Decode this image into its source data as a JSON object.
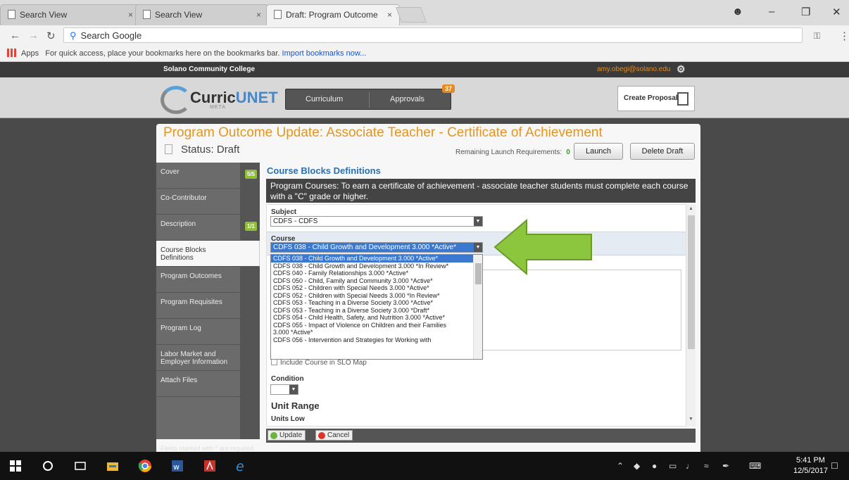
{
  "browser": {
    "tabs": [
      {
        "title": "Search View",
        "active": false
      },
      {
        "title": "Search View",
        "active": false
      },
      {
        "title": "Draft: Program Outcome",
        "active": true
      }
    ],
    "omnibox_text": "Search Google",
    "bookmarks": {
      "apps_label": "Apps",
      "hint": "For quick access, place your bookmarks here on the bookmarks bar.",
      "import_link": "Import bookmarks now..."
    }
  },
  "site": {
    "college": "Solano Community College",
    "email": "amy.obegi@solano.edu",
    "logo_text_a": "Curric",
    "logo_text_b": "UNET",
    "logo_sub": "META",
    "nav": {
      "curriculum": "Curriculum",
      "approvals": "Approvals",
      "approvals_badge": "37"
    },
    "create_proposal": "Create Proposal"
  },
  "page": {
    "title": "Program Outcome Update: Associate Teacher - Certificate of Achievement",
    "status": "Status: Draft",
    "remaining_label": "Remaining Launch Requirements:",
    "remaining_count": "0",
    "launch_label": "Launch",
    "delete_label": "Delete Draft"
  },
  "sidenav": [
    {
      "label": "Cover",
      "count": "5/5"
    },
    {
      "label": "Co-Contributor",
      "count": ""
    },
    {
      "label": "Description",
      "count": "1/1"
    },
    {
      "label": "Course Blocks Definitions",
      "count": "",
      "active": true
    },
    {
      "label": "Program Outcomes",
      "count": ""
    },
    {
      "label": "Program Requisites",
      "count": ""
    },
    {
      "label": "Program Log",
      "count": ""
    },
    {
      "label": "Labor Market and Employer Information",
      "count": ""
    },
    {
      "label": "Attach Files",
      "count": ""
    }
  ],
  "content": {
    "heading": "Course Blocks Definitions",
    "instructions": "Program Courses: To earn a certificate of achievement - associate teacher students must complete each course with a \"C\" grade or higher.",
    "subject_label": "Subject",
    "subject_value": "CDFS - CDFS",
    "course_label": "Course",
    "course_value": "CDFS 038 - Child Growth and Development 3.000 *Active*",
    "include_label": "Include Course in SLO Map",
    "condition_label": "Condition",
    "unit_range_label": "Unit Range",
    "units_low_label": "Units Low",
    "update_label": "Update",
    "cancel_label": "Cancel",
    "required_note": "Fields marked with * are required"
  },
  "course_options": [
    "CDFS 038 - Child Growth and Development 3.000 *Active*",
    "CDFS 038 - Child Growth and Development 3.000 *In Review*",
    "CDFS 040 - Family Relationships 3.000 *Active*",
    "CDFS 050 - Child, Family and Community 3.000 *Active*",
    "CDFS 052 - Children with Special Needs 3.000 *Active*",
    "CDFS 052 - Children with Special Needs 3.000 *In Review*",
    "CDFS 053 - Teaching in a Diverse Society 3.000 *Active*",
    "CDFS 053 - Teaching in a Diverse Society 3.000 *Draft*",
    "CDFS 054 - Child Health, Safety, and Nutrition 3.000 *Active*",
    "CDFS 055 - Impact of Violence on Children and their Families",
    "3.000 *Active*",
    "CDFS 056 - Intervention and Strategies for Working with"
  ],
  "taskbar": {
    "time": "5:41 PM",
    "date": "12/5/2017"
  },
  "colors": {
    "accent": "#e3951f",
    "link": "#2a6fb0",
    "arrow": "#8cc63f",
    "selected": "#3b79d1"
  }
}
